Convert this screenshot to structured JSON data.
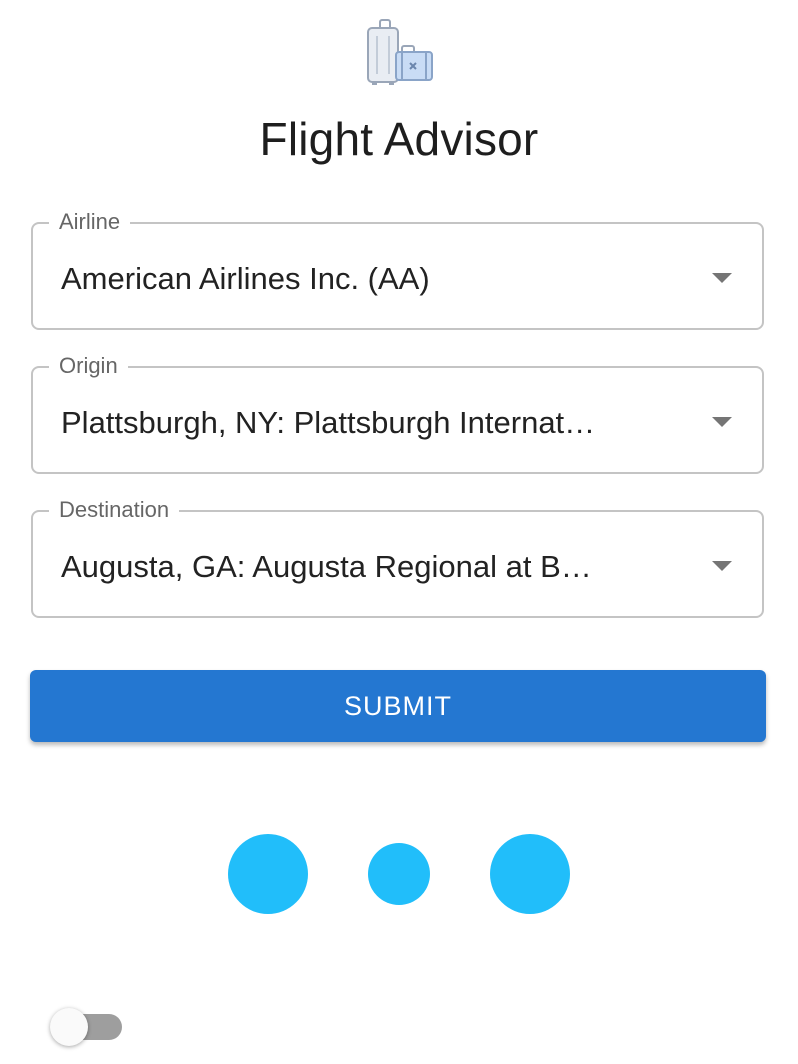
{
  "app": {
    "title": "Flight Advisor",
    "logo_icon": "luggage-icon"
  },
  "form": {
    "fields": [
      {
        "label": "Airline",
        "value": "American Airlines Inc. (AA)"
      },
      {
        "label": "Origin",
        "value": "Plattsburgh, NY: Plattsburgh Internat…"
      },
      {
        "label": "Destination",
        "value": "Augusta, GA: Augusta Regional at B…"
      }
    ],
    "submit_label": "SUBMIT"
  },
  "loader": {
    "color": "#21befa",
    "dots": 3
  },
  "theme_toggle": {
    "checked": false
  },
  "colors": {
    "accent": "#2477d1",
    "loader": "#21befa",
    "border": "#c4c4c4"
  }
}
